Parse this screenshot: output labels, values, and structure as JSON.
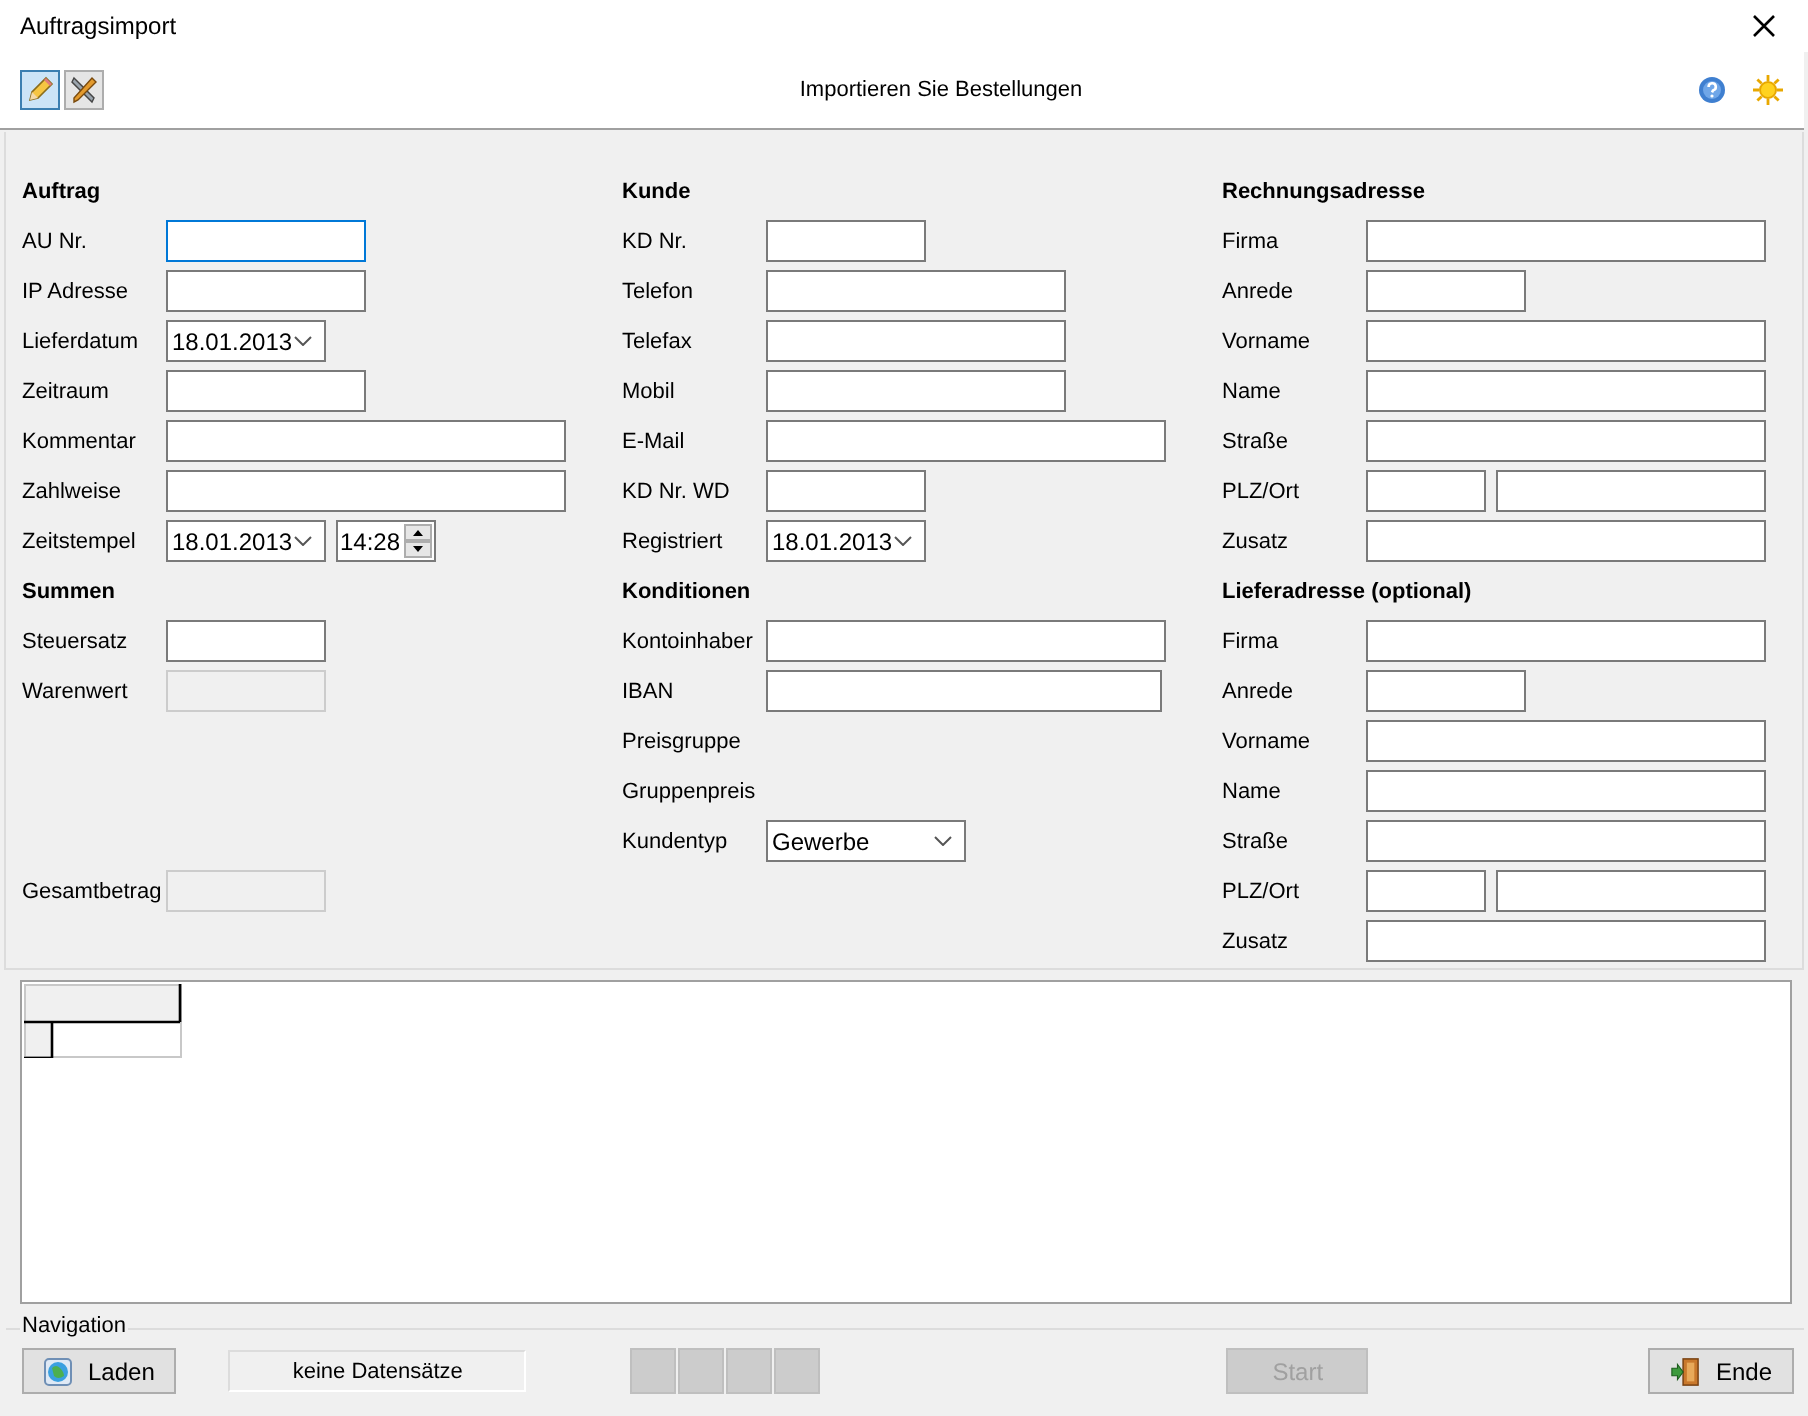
{
  "window": {
    "title": "Auftragsimport"
  },
  "toolbar": {
    "buttons": [
      {
        "selected": true
      },
      {
        "selected": false
      }
    ],
    "title": "Importieren Sie Bestellungen"
  },
  "columns": [
    {
      "sections": [
        {
          "title": "Auftrag",
          "fields": [
            {
              "label": "AU Nr.",
              "kind": "text",
              "focused": true
            },
            {
              "label": "IP Adresse",
              "kind": "text",
              "focused": false
            },
            {
              "label": "Lieferdatum",
              "kind": "date",
              "value": "18.01.2013"
            },
            {
              "label": "Zeitraum",
              "kind": "text",
              "focused": false
            },
            {
              "label": "Kommentar",
              "kind": "text",
              "focused": false
            },
            {
              "label": "Zahlweise",
              "kind": "text",
              "focused": false
            },
            {
              "label": "Zeitstempel",
              "kind": "datetime",
              "value": "18.01.2013",
              "time": "14:28"
            }
          ]
        },
        {
          "title": "Summen",
          "fields": [
            {
              "label": "Steuersatz",
              "kind": "text",
              "focused": false
            },
            {
              "label": "Warenwert",
              "kind": "readonly"
            },
            {
              "label": "Gesamtbetrag",
              "kind": "readonly"
            }
          ]
        }
      ]
    },
    {
      "sections": [
        {
          "title": "Kunde",
          "fields": [
            {
              "label": "KD Nr.",
              "kind": "text",
              "focused": false
            },
            {
              "label": "Telefon",
              "kind": "text",
              "focused": false
            },
            {
              "label": "Telefax",
              "kind": "text",
              "focused": false
            },
            {
              "label": "Mobil",
              "kind": "text",
              "focused": false
            },
            {
              "label": "E-Mail",
              "kind": "text",
              "focused": false
            },
            {
              "label": "KD Nr. WD",
              "kind": "text",
              "focused": false
            },
            {
              "label": "Registriert",
              "kind": "date",
              "value": "18.01.2013"
            }
          ]
        },
        {
          "title": "Konditionen",
          "fields": [
            {
              "label": "Kontoinhaber",
              "kind": "text",
              "focused": false
            },
            {
              "label": "IBAN",
              "kind": "text",
              "focused": false
            },
            {
              "label": "Preisgruppe",
              "kind": "label"
            },
            {
              "label": "Gruppenpreis",
              "kind": "label"
            },
            {
              "label": "Kundentyp",
              "kind": "select",
              "value": "Gewerbe"
            }
          ]
        }
      ]
    },
    {
      "sections": [
        {
          "title": "Rechnungsadresse",
          "fields": [
            {
              "label": "Firma",
              "kind": "text",
              "focused": false
            },
            {
              "label": "Anrede",
              "kind": "text",
              "focused": false
            },
            {
              "label": "Vorname",
              "kind": "text",
              "focused": false
            },
            {
              "label": "Name",
              "kind": "text",
              "focused": false
            },
            {
              "label": "Straße",
              "kind": "text",
              "focused": false
            },
            {
              "label": "PLZ/Ort",
              "kind": "plz"
            },
            {
              "label": "Zusatz",
              "kind": "text",
              "focused": false
            }
          ]
        },
        {
          "title": "Lieferadresse (optional)",
          "fields": [
            {
              "label": "Firma",
              "kind": "text",
              "focused": false
            },
            {
              "label": "Anrede",
              "kind": "text",
              "focused": false
            },
            {
              "label": "Vorname",
              "kind": "text",
              "focused": false
            },
            {
              "label": "Name",
              "kind": "text",
              "focused": false
            },
            {
              "label": "Straße",
              "kind": "text",
              "focused": false
            },
            {
              "label": "PLZ/Ort",
              "kind": "plz"
            },
            {
              "label": "Zusatz",
              "kind": "text",
              "focused": false
            }
          ]
        }
      ]
    }
  ],
  "navigation": {
    "label": "Navigation",
    "load_button": {
      "label": "Laden"
    },
    "status": "keine Datensätze",
    "nav_buttons": [
      {
        "disabled": true
      },
      {
        "disabled": true
      },
      {
        "disabled": true
      },
      {
        "disabled": true
      }
    ],
    "start_button": {
      "label": "Start",
      "disabled": true
    },
    "end_button": {
      "label": "Ende",
      "disabled": false
    }
  }
}
